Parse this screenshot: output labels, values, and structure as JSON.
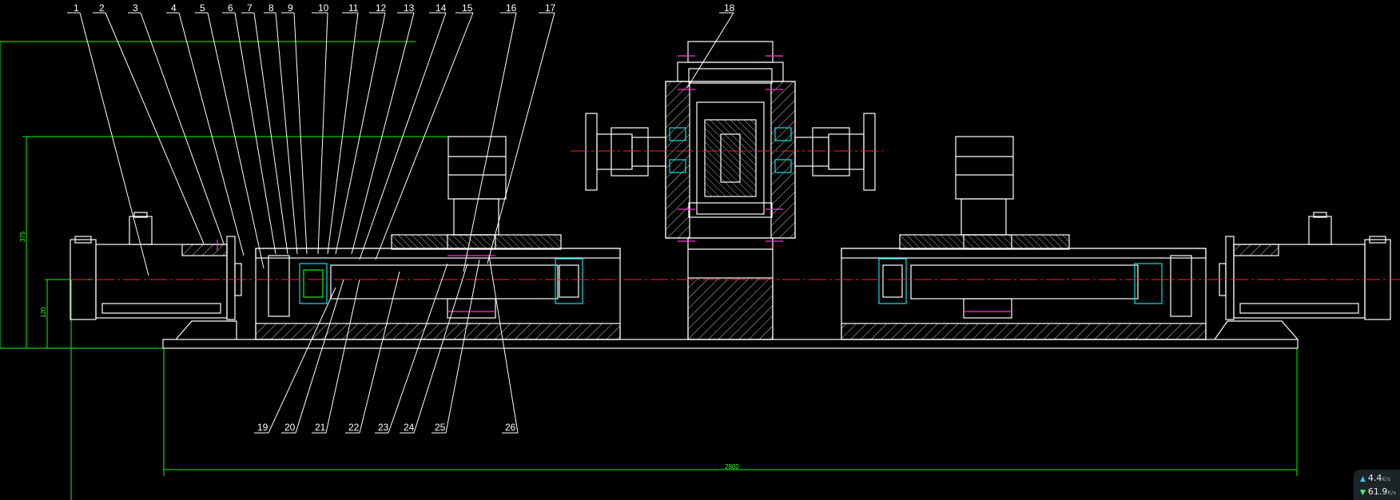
{
  "drawing": {
    "top_labels": [
      "1",
      "2",
      "3",
      "4",
      "5",
      "6",
      "7",
      "8",
      "9",
      "10",
      "11",
      "12",
      "13",
      "14",
      "15",
      "16",
      "17",
      "18"
    ],
    "bottom_labels": [
      "19",
      "20",
      "21",
      "22",
      "23",
      "24",
      "25",
      "26"
    ],
    "dim_overall_height": "375",
    "dim_axis_height": "120",
    "dim_base_length": "2800"
  },
  "colors": {
    "background": "#000000",
    "outline": "#ffffff",
    "dimension": "#00ff00",
    "centerline": "#ff2020",
    "bearing": "#00e5e5",
    "fastener": "#ff33cc",
    "hatch": "#ffffff"
  },
  "net_widget": {
    "up_value": "4.4",
    "up_unit": "K/s",
    "down_value": "61.9",
    "down_unit": "K/s",
    "up_icon": "arrow-up-icon",
    "down_icon": "arrow-down-icon"
  }
}
